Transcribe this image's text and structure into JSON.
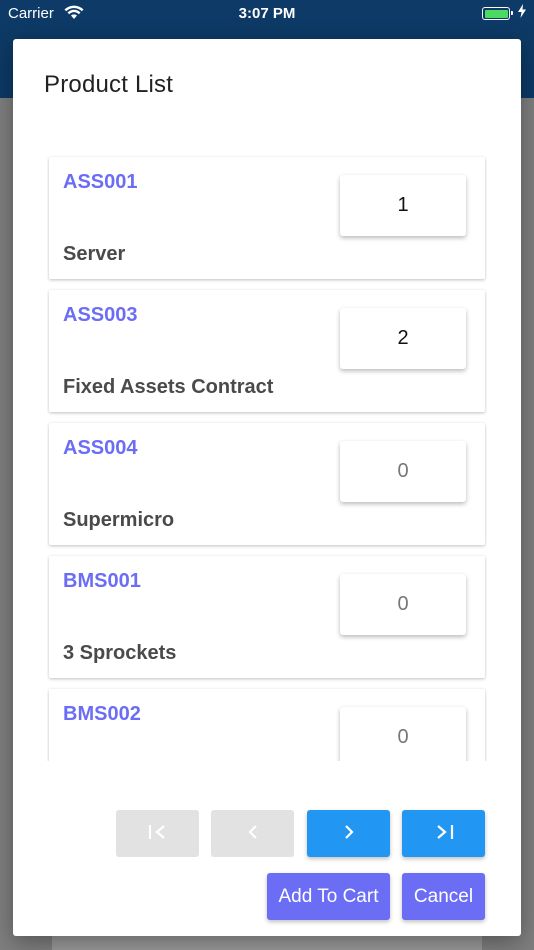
{
  "status_bar": {
    "carrier": "Carrier",
    "time": "3:07 PM",
    "battery_color": "#4cd964"
  },
  "colors": {
    "header": "#0d3a66",
    "accent": "#6b6ef5",
    "pager_active": "#2196f3",
    "pager_disabled": "#e2e2e2"
  },
  "modal": {
    "title": "Product List",
    "products": [
      {
        "code": "ASS001",
        "name": "Server",
        "qty": "1"
      },
      {
        "code": "ASS003",
        "name": "Fixed Assets Contract",
        "qty": "2"
      },
      {
        "code": "ASS004",
        "name": "Supermicro",
        "qty": "0"
      },
      {
        "code": "BMS001",
        "name": "3 Sprockets",
        "qty": "0"
      },
      {
        "code": "BMS002",
        "name": "",
        "qty": "0"
      }
    ],
    "pagination": {
      "first": {
        "icon": "first-page-icon",
        "glyph": "I<",
        "enabled": false
      },
      "prev": {
        "icon": "chevron-left-icon",
        "glyph": "<",
        "enabled": false
      },
      "next": {
        "icon": "chevron-right-icon",
        "glyph": ">",
        "enabled": true
      },
      "last": {
        "icon": "last-page-icon",
        "glyph": ">I",
        "enabled": true
      }
    },
    "add_to_cart_label": "Add To Cart",
    "cancel_label": "Cancel"
  }
}
